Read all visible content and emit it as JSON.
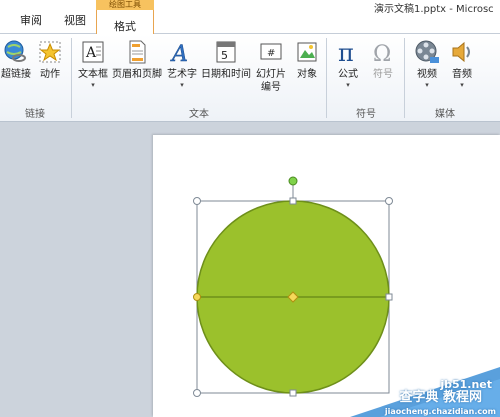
{
  "window": {
    "title": "演示文稿1.pptx - Microsc"
  },
  "tabs": [
    {
      "label": "审阅"
    },
    {
      "label": "视图"
    },
    {
      "label": "格式",
      "active": true,
      "contextual_label": "绘图工具"
    }
  ],
  "ribbon": {
    "groups": [
      {
        "label": "链接",
        "buttons": [
          {
            "label": "超链接",
            "icon": "hyperlink-globe-icon"
          },
          {
            "label": "动作",
            "icon": "action-star-icon"
          }
        ]
      },
      {
        "label": "文本",
        "buttons": [
          {
            "label": "文本框",
            "icon": "textbox-icon",
            "has_dropdown": true
          },
          {
            "label": "页眉和页脚",
            "icon": "header-footer-icon"
          },
          {
            "label": "艺术字",
            "icon": "wordart-icon",
            "has_dropdown": true
          },
          {
            "label": "日期和时间",
            "icon": "date-time-icon"
          },
          {
            "label": "幻灯片\n编号",
            "line1": "幻灯片",
            "line2": "编号",
            "icon": "slide-number-icon"
          },
          {
            "label": "对象",
            "icon": "object-icon"
          }
        ]
      },
      {
        "label": "符号",
        "buttons": [
          {
            "label": "公式",
            "icon": "pi-equation-icon",
            "has_dropdown": true
          },
          {
            "label": "符号",
            "icon": "omega-symbol-icon",
            "disabled": true
          }
        ]
      },
      {
        "label": "媒体",
        "buttons": [
          {
            "label": "视频",
            "icon": "video-reel-icon",
            "has_dropdown": true
          },
          {
            "label": "音频",
            "icon": "speaker-audio-icon",
            "has_dropdown": true
          }
        ]
      }
    ]
  },
  "shape": {
    "type": "circle",
    "fill": "#9bc12c",
    "stroke": "#6e8f1a",
    "selected": true
  },
  "colors": {
    "tab_accent": "#e8a550",
    "contextual_tab": "#f7c25f",
    "handle": "#ffffff",
    "rotate_handle": "#7fd24a",
    "adjust_handle": "#f5d85a"
  },
  "watermark": {
    "text1": "jb51.net",
    "text2": "查字典 教程网",
    "text3": "jiaocheng.chazidian.com"
  }
}
